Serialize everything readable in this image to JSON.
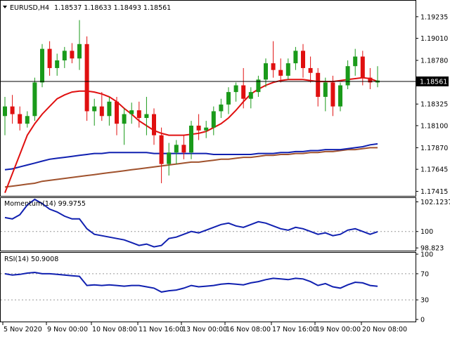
{
  "header": {
    "symbol": "EURUSD,H4",
    "ohlc": "1.18537 1.18633 1.18493 1.18561"
  },
  "colors": {
    "bull": "#1a9a1a",
    "bear": "#e01010",
    "sma_fast": "#e01010",
    "sma_mid": "#1020b0",
    "sma_slow": "#a0522d",
    "indicator": "#1020b0",
    "current_price_line": "#000000"
  },
  "chart_data": [
    {
      "type": "candlestick",
      "title": "EURUSD,H4",
      "ylim": [
        1.1739,
        1.1938
      ],
      "yticks": [
        "1.19235",
        "1.19010",
        "1.18780",
        "1.18555",
        "1.18325",
        "1.18100",
        "1.17870",
        "1.17645",
        "1.17415"
      ],
      "current_price": "1.18561",
      "x_labels": [
        "5 Nov 2020",
        "9 Nov 00:00",
        "10 Nov 08:00",
        "11 Nov 16:00",
        "13 Nov 00:00",
        "16 Nov 08:00",
        "17 Nov 16:00",
        "19 Nov 00:00",
        "20 Nov 08:00"
      ],
      "ohlc": [
        [
          1.182,
          1.184,
          1.18,
          1.183
        ],
        [
          1.183,
          1.1842,
          1.1812,
          1.1822
        ],
        [
          1.1822,
          1.183,
          1.1805,
          1.1812
        ],
        [
          1.1812,
          1.1825,
          1.1808,
          1.182
        ],
        [
          1.182,
          1.186,
          1.1815,
          1.1855
        ],
        [
          1.1855,
          1.1895,
          1.185,
          1.189
        ],
        [
          1.189,
          1.1898,
          1.1862,
          1.187
        ],
        [
          1.187,
          1.1885,
          1.1862,
          1.1878
        ],
        [
          1.1878,
          1.1892,
          1.187,
          1.1888
        ],
        [
          1.1888,
          1.1896,
          1.1875,
          1.188
        ],
        [
          1.188,
          1.192,
          1.1868,
          1.1895
        ],
        [
          1.1895,
          1.1903,
          1.1815,
          1.1825
        ],
        [
          1.1825,
          1.1838,
          1.181,
          1.183
        ],
        [
          1.183,
          1.1845,
          1.1815,
          1.182
        ],
        [
          1.182,
          1.184,
          1.181,
          1.1835
        ],
        [
          1.1835,
          1.184,
          1.18,
          1.1812
        ],
        [
          1.1812,
          1.1828,
          1.179,
          1.1822
        ],
        [
          1.1822,
          1.1834,
          1.1812,
          1.1826
        ],
        [
          1.1826,
          1.1835,
          1.1808,
          1.1818
        ],
        [
          1.1818,
          1.184,
          1.18,
          1.1822
        ],
        [
          1.1822,
          1.1828,
          1.179,
          1.18
        ],
        [
          1.18,
          1.1808,
          1.175,
          1.177
        ],
        [
          1.177,
          1.1792,
          1.1758,
          1.1782
        ],
        [
          1.1782,
          1.1795,
          1.177,
          1.179
        ],
        [
          1.179,
          1.18,
          1.1775,
          1.1782
        ],
        [
          1.1782,
          1.1815,
          1.1775,
          1.181
        ],
        [
          1.181,
          1.1822,
          1.1795,
          1.1805
        ],
        [
          1.1805,
          1.1815,
          1.1797,
          1.1808
        ],
        [
          1.1808,
          1.183,
          1.18,
          1.1825
        ],
        [
          1.1825,
          1.1838,
          1.1818,
          1.1832
        ],
        [
          1.1832,
          1.185,
          1.1822,
          1.1845
        ],
        [
          1.1845,
          1.1855,
          1.1835,
          1.1852
        ],
        [
          1.1852,
          1.187,
          1.1828,
          1.1838
        ],
        [
          1.1838,
          1.185,
          1.1828,
          1.1845
        ],
        [
          1.1845,
          1.1862,
          1.184,
          1.1858
        ],
        [
          1.1858,
          1.188,
          1.185,
          1.1875
        ],
        [
          1.1875,
          1.1898,
          1.186,
          1.1868
        ],
        [
          1.1868,
          1.188,
          1.1855,
          1.1862
        ],
        [
          1.1862,
          1.188,
          1.1858,
          1.1875
        ],
        [
          1.1875,
          1.1892,
          1.1868,
          1.1888
        ],
        [
          1.1888,
          1.1895,
          1.186,
          1.187
        ],
        [
          1.187,
          1.1882,
          1.1855,
          1.1865
        ],
        [
          1.1865,
          1.187,
          1.183,
          1.184
        ],
        [
          1.184,
          1.186,
          1.1825,
          1.1855
        ],
        [
          1.1855,
          1.1862,
          1.182,
          1.183
        ],
        [
          1.183,
          1.1855,
          1.1825,
          1.1852
        ],
        [
          1.1852,
          1.1878,
          1.1848,
          1.1872
        ],
        [
          1.1872,
          1.189,
          1.1862,
          1.1882
        ],
        [
          1.1882,
          1.1888,
          1.1852,
          1.186
        ],
        [
          1.186,
          1.187,
          1.1848,
          1.1855
        ],
        [
          1.1855,
          1.1872,
          1.185,
          1.1857
        ]
      ],
      "sma_fast": [
        1.174,
        1.176,
        1.178,
        1.18,
        1.1812,
        1.1822,
        1.183,
        1.1838,
        1.1842,
        1.1845,
        1.1846,
        1.1846,
        1.1845,
        1.1843,
        1.184,
        1.1835,
        1.1828,
        1.1822,
        1.1815,
        1.181,
        1.1805,
        1.1802,
        1.18,
        1.18,
        1.18,
        1.1801,
        1.1802,
        1.1804,
        1.1808,
        1.1812,
        1.1818,
        1.1826,
        1.1835,
        1.1843,
        1.1848,
        1.1852,
        1.1855,
        1.1857,
        1.1858,
        1.1858,
        1.1858,
        1.1857,
        1.1856,
        1.1856,
        1.1856,
        1.1857,
        1.1858,
        1.1859,
        1.186,
        1.1859,
        1.1856
      ],
      "sma_mid": [
        1.1764,
        1.1765,
        1.1767,
        1.1769,
        1.1771,
        1.1773,
        1.1775,
        1.1776,
        1.1777,
        1.1778,
        1.1779,
        1.178,
        1.1781,
        1.1781,
        1.1782,
        1.1782,
        1.1782,
        1.1782,
        1.1782,
        1.1782,
        1.1781,
        1.1781,
        1.1781,
        1.1781,
        1.1781,
        1.1781,
        1.1781,
        1.1781,
        1.178,
        1.178,
        1.178,
        1.178,
        1.178,
        1.178,
        1.1781,
        1.1781,
        1.1781,
        1.1782,
        1.1782,
        1.1783,
        1.1783,
        1.1784,
        1.1784,
        1.1785,
        1.1785,
        1.1785,
        1.1786,
        1.1787,
        1.1788,
        1.179,
        1.1791
      ],
      "sma_slow": [
        1.1746,
        1.1747,
        1.1748,
        1.1749,
        1.175,
        1.1752,
        1.1753,
        1.1754,
        1.1755,
        1.1756,
        1.1757,
        1.1758,
        1.1759,
        1.176,
        1.1761,
        1.1762,
        1.1763,
        1.1764,
        1.1765,
        1.1766,
        1.1767,
        1.1768,
        1.1769,
        1.177,
        1.1771,
        1.1772,
        1.1772,
        1.1773,
        1.1774,
        1.1775,
        1.1775,
        1.1776,
        1.1777,
        1.1777,
        1.1778,
        1.1779,
        1.1779,
        1.178,
        1.178,
        1.1781,
        1.1781,
        1.1782,
        1.1782,
        1.1783,
        1.1783,
        1.1784,
        1.1785,
        1.1785,
        1.1786,
        1.1787,
        1.1787
      ]
    },
    {
      "type": "line",
      "title": "Momentum(14) 99.9755",
      "ylim": [
        98.78,
        102.2
      ],
      "yticks": [
        "102.1237",
        "100",
        "98.823"
      ],
      "reference_line": 100,
      "values": [
        101.0,
        100.9,
        101.2,
        101.9,
        102.3,
        102.0,
        101.6,
        101.4,
        101.1,
        100.9,
        100.9,
        100.2,
        99.8,
        99.7,
        99.6,
        99.5,
        99.4,
        99.2,
        99.0,
        99.1,
        98.9,
        99.0,
        99.5,
        99.6,
        99.8,
        100.0,
        99.9,
        100.1,
        100.3,
        100.5,
        100.6,
        100.4,
        100.3,
        100.5,
        100.7,
        100.6,
        100.4,
        100.2,
        100.1,
        100.3,
        100.2,
        100.0,
        99.8,
        99.9,
        99.7,
        99.8,
        100.1,
        100.2,
        100.0,
        99.8,
        99.98
      ]
    },
    {
      "type": "line",
      "title": "RSI(14) 50.9008",
      "ylim": [
        0,
        100
      ],
      "yticks": [
        "100",
        "70",
        "30",
        "0"
      ],
      "reference_lines": [
        70,
        30
      ],
      "values": [
        70,
        68,
        69,
        71,
        72,
        70,
        70,
        69,
        68,
        67,
        66,
        52,
        53,
        52,
        53,
        52,
        51,
        52,
        52,
        50,
        48,
        42,
        44,
        45,
        48,
        52,
        50,
        51,
        52,
        54,
        55,
        54,
        53,
        56,
        58,
        61,
        63,
        62,
        61,
        63,
        62,
        58,
        52,
        55,
        50,
        48,
        53,
        57,
        56,
        52,
        50.9
      ]
    }
  ]
}
